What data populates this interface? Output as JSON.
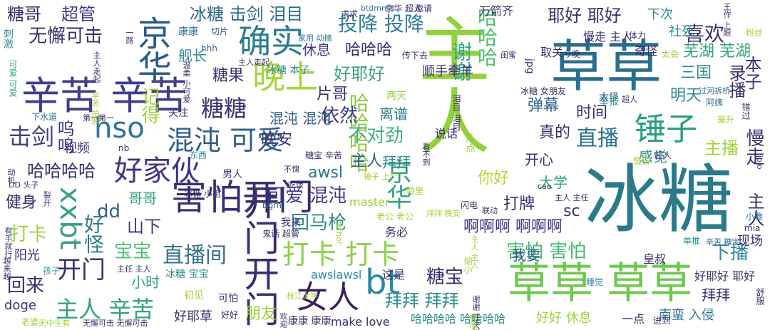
{
  "words": [
    {
      "text": "冰糖",
      "color": "#2a7a8a"
    },
    {
      "text": "主人",
      "color": "#93d13a"
    },
    {
      "text": "草草",
      "color": "#2a6e8c"
    },
    {
      "text": "草草 草草",
      "color": "#6cc94c"
    },
    {
      "text": "开门开门",
      "color": "#3b2d6e"
    },
    {
      "text": "害怕开门",
      "color": "#3b2d6e"
    },
    {
      "text": "辛苦 辛苦",
      "color": "#3e3f86"
    },
    {
      "text": "京华",
      "color": "#2c5a8a"
    },
    {
      "text": "京华",
      "color": "#33a47a"
    },
    {
      "text": "确实",
      "color": "#2b7d8b"
    },
    {
      "text": "锤子",
      "color": "#2a9f80"
    },
    {
      "text": "晚上",
      "color": "#a6d637"
    },
    {
      "text": "混沌 可爱",
      "color": "#2f5f8d"
    },
    {
      "text": "好家伙",
      "color": "#3d3585"
    },
    {
      "text": "xxbt",
      "color": "#3b9e87"
    },
    {
      "text": "bt",
      "color": "#2e88a0"
    },
    {
      "text": "女人",
      "color": "#3c1f5a"
    },
    {
      "text": "打卡 打卡",
      "color": "#8fd04a"
    },
    {
      "text": "直播间",
      "color": "#3a6f8a"
    },
    {
      "text": "主人 辛苦",
      "color": "#33a37a"
    },
    {
      "text": "hso",
      "color": "#2d73a0"
    },
    {
      "text": "投降 投降",
      "color": "#2e7ea0"
    },
    {
      "text": "哈哈哈哈",
      "color": "#8acb3e"
    },
    {
      "text": "哈哈哈",
      "color": "#4fbf6a"
    },
    {
      "text": "谢谢",
      "color": "#37a58a"
    },
    {
      "text": "直播",
      "color": "#2e7192"
    },
    {
      "text": "击剑",
      "color": "#3e3a7f"
    },
    {
      "text": "糖糖",
      "color": "#3e2f6e"
    },
    {
      "text": "喜欢",
      "color": "#3d2c6a"
    },
    {
      "text": "冰糖 击剑 泪目",
      "color": "#2d6a8a"
    },
    {
      "text": "无懈可击",
      "color": "#3c2f6c"
    },
    {
      "text": "糖哥",
      "color": "#3d2c66"
    },
    {
      "text": "超管",
      "color": "#3e3a7f"
    },
    {
      "text": "耶好 耶好",
      "color": "#3d2c6a"
    },
    {
      "text": "休息",
      "color": "#3e3a7f"
    },
    {
      "text": "哈哈哈",
      "color": "#3d2c6a"
    },
    {
      "text": "好耶好",
      "color": "#40a085"
    },
    {
      "text": "顺手牵羊",
      "color": "#3c2f6c"
    },
    {
      "text": "害怕 害怕",
      "color": "#47b872"
    },
    {
      "text": "可爱 混沌",
      "color": "#3d3585"
    },
    {
      "text": "回马枪",
      "color": "#2f8d8c"
    },
    {
      "text": "拜拜 拜拜",
      "color": "#2f8d8c"
    },
    {
      "text": "糖宝",
      "color": "#3c2f6c"
    },
    {
      "text": "哈哈哈哈",
      "color": "#3c2f6c"
    },
    {
      "text": "awsl",
      "color": "#2e7192"
    },
    {
      "text": "主人",
      "color": "#2f5f8d"
    },
    {
      "text": "拜拜",
      "color": "#2f8d8c"
    },
    {
      "text": "依然",
      "color": "#3d3585"
    },
    {
      "text": "不对劲",
      "color": "#41b07b"
    },
    {
      "text": "离谱",
      "color": "#2c7a8a"
    },
    {
      "text": "片哥",
      "color": "#3c2f6c"
    },
    {
      "text": "混沌 混沌",
      "color": "#2f5f8d"
    },
    {
      "text": "晚安",
      "color": "#3c2f6c"
    },
    {
      "text": "宝宝",
      "color": "#4ec07a"
    },
    {
      "text": "回来",
      "color": "#3c2f6c"
    },
    {
      "text": "打卡",
      "color": "#a1d23c"
    },
    {
      "text": "开门",
      "color": "#3c2f6c"
    },
    {
      "text": "健身",
      "color": "#3c2f6c"
    },
    {
      "text": "dd",
      "color": "#2f5f8d"
    },
    {
      "text": "哥哥",
      "color": "#33a37a"
    },
    {
      "text": "好怪",
      "color": "#2c7a8a"
    },
    {
      "text": "山下",
      "color": "#3e3a7f"
    },
    {
      "text": "你好",
      "color": "#b4d933"
    },
    {
      "text": "大学",
      "color": "#33a37a"
    },
    {
      "text": "打牌",
      "color": "#3c2f6c"
    },
    {
      "text": "sc",
      "color": "#3c2f6c"
    },
    {
      "text": "啊啊啊 啊啊啊",
      "color": "#3d3585"
    },
    {
      "text": "我要",
      "color": "#2f5f8d"
    },
    {
      "text": "下播",
      "color": "#2e88a0"
    },
    {
      "text": "现场",
      "color": "#3c2f6c"
    },
    {
      "text": "真的",
      "color": "#3c2f6c"
    },
    {
      "text": "开心",
      "color": "#3c2f6c"
    },
    {
      "text": "弹幕",
      "color": "#2f5f8d"
    },
    {
      "text": "时间",
      "color": "#3c2f6c"
    },
    {
      "text": "明天",
      "color": "#2e88a0"
    },
    {
      "text": "芜湖 芜湖",
      "color": "#33a37a"
    },
    {
      "text": "三国",
      "color": "#2f8d8c"
    },
    {
      "text": "录播",
      "color": "#3c2f6c"
    },
    {
      "text": "本子",
      "color": "#3c2f6c"
    },
    {
      "text": "慢走",
      "color": "#3c2f6c"
    },
    {
      "text": "主播",
      "color": "#a1d23c"
    },
    {
      "text": "感觉",
      "color": "#2f8d8c"
    },
    {
      "text": "主人",
      "color": "#3c2f6c"
    },
    {
      "text": "舰长",
      "color": "#2e88a0"
    },
    {
      "text": "糖果",
      "color": "#3c2f6c"
    },
    {
      "text": "记得",
      "color": "#a1d23c"
    },
    {
      "text": "呜呜",
      "color": "#3d3585"
    },
    {
      "text": "视频",
      "color": "#3e3a7f"
    },
    {
      "text": "下次",
      "color": "#2f8d8c"
    },
    {
      "text": "社死",
      "color": "#2f8d8c"
    },
    {
      "text": "取关",
      "color": "#3c2f6c"
    },
    {
      "text": "慢走 主人",
      "color": "#3c2f6c"
    },
    {
      "text": "奇怪",
      "color": "#3c2f6c"
    },
    {
      "text": "南蛮 入侵",
      "color": "#2e7192"
    },
    {
      "text": "一点",
      "color": "#3c2f6c"
    },
    {
      "text": "好好 休息",
      "color": "#a1d23c"
    },
    {
      "text": "哈哈哈哈 哈哈哈哈",
      "color": "#2f8d8c"
    },
    {
      "text": "拜拜",
      "color": "#3c2f6c"
    },
    {
      "text": "朋友",
      "color": "#a1d23c"
    },
    {
      "text": "好耶草",
      "color": "#3c2f6c"
    },
    {
      "text": "doge",
      "color": "#3c2f6c"
    },
    {
      "text": "阳光",
      "color": "#3c2f6c"
    },
    {
      "text": "小时",
      "color": "#33a37a"
    },
    {
      "text": "awslawsl",
      "color": "#2e88a0"
    },
    {
      "text": "make love",
      "color": "#3c2f6c"
    },
    {
      "text": "康康 康康",
      "color": "#3c2f6c"
    },
    {
      "text": "好耶好 耶好",
      "color": "#3c2f6c"
    },
    {
      "text": "皇叔",
      "color": "#3c2f6c"
    },
    {
      "text": "冰糖 宝宝",
      "color": "#2f8d8c"
    },
    {
      "text": "初见",
      "color": "#a1d23c"
    },
    {
      "text": "可怕",
      "color": "#3c2f6c"
    },
    {
      "text": "务必",
      "color": "#3c2f6c"
    },
    {
      "text": "这是",
      "color": "#3c2f6c"
    },
    {
      "text": "master",
      "color": "#a1d23c"
    },
    {
      "text": "我来",
      "color": "#3c2f6c"
    },
    {
      "text": "万箭齐",
      "color": "#3c2f6c"
    },
    {
      "text": "关注",
      "color": "#3c2f6c"
    },
    {
      "text": "举报",
      "color": "#2f8d8c"
    },
    {
      "text": "说话",
      "color": "#3c2f6c"
    },
    {
      "text": "两天",
      "color": "#a1d23c"
    },
    {
      "text": "京华 超人",
      "color": "#3c2f6c"
    },
    {
      "text": "好好",
      "color": "#3c2f6c"
    },
    {
      "text": "老婆",
      "color": "#a1d23c"
    },
    {
      "text": "冰糖 女朋友",
      "color": "#3c2f6c"
    },
    {
      "text": "冰糖 本子",
      "color": "#2f8d8c"
    },
    {
      "text": "康康",
      "color": "#2e7192"
    },
    {
      "text": "切片",
      "color": "#2f5f8d"
    },
    {
      "text": "hhh",
      "color": "#2f5f8d"
    },
    {
      "text": "jpg",
      "color": "#3c2f6c"
    },
    {
      "text": "nb",
      "color": "#3c2f6c"
    },
    {
      "text": "mia",
      "color": "#3c2f6c"
    },
    {
      "text": "bgm",
      "color": "#2f5f8d"
    },
    {
      "text": "东西",
      "color": "#2e88a0"
    },
    {
      "text": "男人",
      "color": "#3c2f6c"
    },
    {
      "text": "超人",
      "color": "#3c2f6c"
    },
    {
      "text": "太怪",
      "color": "#2f5f8d"
    },
    {
      "text": "体力",
      "color": "#3c2f6c"
    },
    {
      "text": "今晚",
      "color": "#3c2f6c"
    },
    {
      "text": "太会",
      "color": "#a1d23c"
    },
    {
      "text": "刺激",
      "color": "#2f8d8c"
    },
    {
      "text": "可爱 可爱",
      "color": "#33a37a"
    },
    {
      "text": "下水道",
      "color": "#2e7192"
    },
    {
      "text": "求求",
      "color": "#3c2f6c"
    },
    {
      "text": "邀请",
      "color": "#3c2f6c"
    },
    {
      "text": "btdmmd",
      "color": "#2e7192"
    },
    {
      "text": "毫升",
      "color": "#a1d23c"
    },
    {
      "text": "阿姨",
      "color": "#2e7192"
    },
    {
      "text": "错过",
      "color": "#3c2f6c"
    },
    {
      "text": "粉丝",
      "color": "#a1d23c"
    },
    {
      "text": "单推",
      "color": "#2f8d8c"
    },
    {
      "text": "孩子",
      "color": "#2f8d8c"
    },
    {
      "text": "鬼话 超管",
      "color": "#3c2f6c"
    },
    {
      "text": "老公 老公",
      "color": "#a1d23c"
    },
    {
      "text": "闪电",
      "color": "#3c2f6c"
    },
    {
      "text": "联动",
      "color": "#3c2f6c"
    },
    {
      "text": "帕里",
      "color": "#a1d23c"
    },
    {
      "text": "睡觉",
      "color": "#2e88a0"
    },
    {
      "text": "进到",
      "color": "#3c2f6c"
    },
    {
      "text": "舒服",
      "color": "#3c2f6c"
    },
    {
      "text": "警告",
      "color": "#a1d23c"
    },
    {
      "text": "糖宝 辛苦",
      "color": "#3c2f6c"
    },
    {
      "text": "小雅",
      "color": "#2e7192"
    },
    {
      "text": "辛苦 糖宝",
      "color": "#2e7192"
    },
    {
      "text": "冰糖 小姐",
      "color": "#3c2f6c"
    },
    {
      "text": "无懈可击 无懈可击",
      "color": "#3c2f6c"
    },
    {
      "text": "无中生有",
      "color": "#a1d23c"
    },
    {
      "text": "主任 主人",
      "color": "#3c2f6c"
    },
    {
      "text": "第一第一",
      "color": "#3c2f6c"
    },
    {
      "text": "传下去",
      "color": "#3c2f6c"
    },
    {
      "text": "闺蜜",
      "color": "#3c2f6c"
    },
    {
      "text": "主人 主任",
      "color": "#3c2f6c"
    },
    {
      "text": "家用 动摘",
      "color": "#2e7192"
    },
    {
      "text": "拜拜 晚安",
      "color": "#a1d23c"
    },
    {
      "text": "cao",
      "color": "#3c2f6c"
    },
    {
      "text": "八点",
      "color": "#a1d23c"
    },
    {
      "text": "主人走起",
      "color": "#3c2f6c"
    },
    {
      "text": "吃饭",
      "color": "#3c2f6c"
    },
    {
      "text": "不愧",
      "color": "#3c2f6c"
    },
    {
      "text": "DD 头子",
      "color": "#3c2f6c"
    },
    {
      "text": "枝江大学",
      "color": "#a1d23c"
    },
    {
      "text": "过河拆桥",
      "color": "#2e7192"
    },
    {
      "text": "锤子 上个",
      "color": "#a1d23c"
    },
    {
      "text": "看不到",
      "color": "#3c2f6c"
    },
    {
      "text": "谢谢 任天堂",
      "color": "#3c2f6c"
    },
    {
      "text": "缩小",
      "color": "#a1d23c"
    },
    {
      "text": "泪目 泪目",
      "color": "#3c2f6c"
    },
    {
      "text": "一路",
      "color": "#3c2f6c"
    },
    {
      "text": "主人走起",
      "color": "#3c2f6c"
    },
    {
      "text": "有手就行",
      "color": "#3c2f6c"
    },
    {
      "text": "越来越",
      "color": "#3c2f6c"
    },
    {
      "text": "裂开",
      "color": "#3c2f6c"
    },
    {
      "text": "动机",
      "color": "#3c2f6c"
    },
    {
      "text": "jojo",
      "color": "#3c2f6c"
    },
    {
      "text": "超人",
      "color": "#3c2f6c"
    },
    {
      "text": "father",
      "color": "#a1d23c"
    },
    {
      "text": "欢迎",
      "color": "#3c2f6c"
    },
    {
      "text": "神像",
      "color": "#a1d23c"
    },
    {
      "text": "王作 上眼",
      "color": "#3c2f6c"
    },
    {
      "text": "温柔 小可爱",
      "color": "#3c2f6c"
    },
    {
      "text": "辛苦 拍照",
      "color": "#a1d23c"
    },
    {
      "text": "主人 主人",
      "color": "#a1d23c"
    }
  ]
}
